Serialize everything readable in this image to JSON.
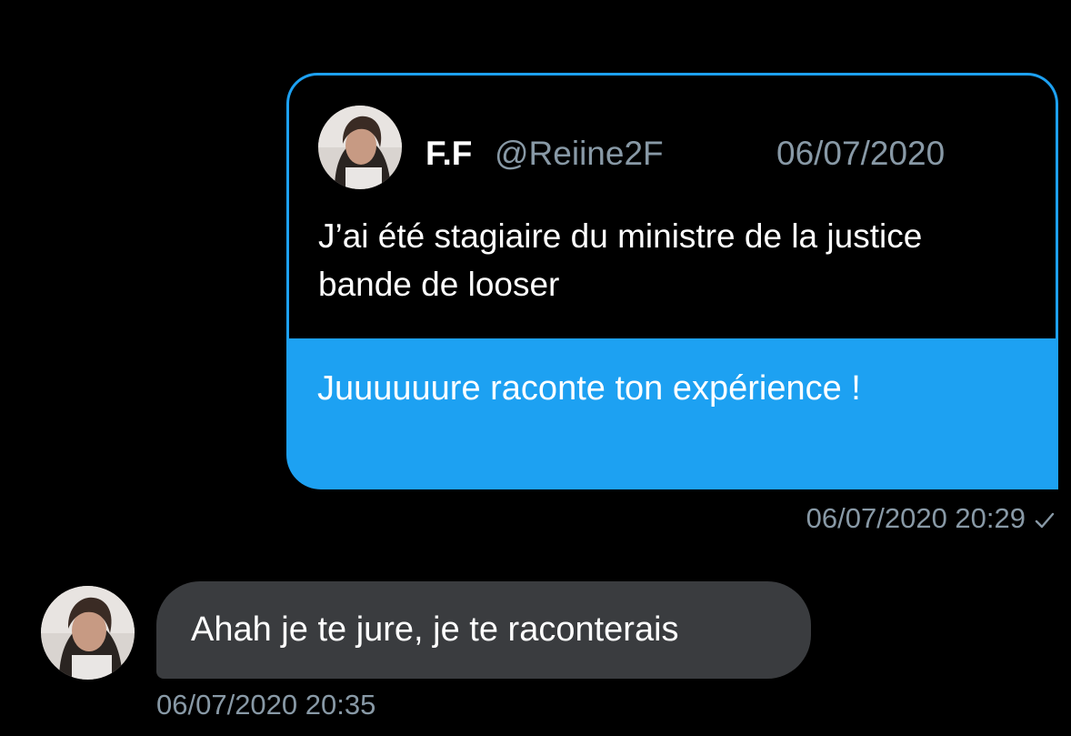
{
  "colors": {
    "background": "#000000",
    "accent": "#1da1f2",
    "muted_text": "#8899a6",
    "received_bubble": "#3a3c3f"
  },
  "sent_message": {
    "quoted_tweet": {
      "display_name": "F.F",
      "handle": "@Reiine2F",
      "date": "06/07/2020",
      "text": "J’ai été stagiaire du ministre de la justice bande de looser",
      "avatar_icon": "profile-photo-avatar"
    },
    "text": "Juuuuuure raconte ton expérience !",
    "timestamp": "06/07/2020 20:29",
    "status_icon": "check-icon"
  },
  "received_message": {
    "avatar_icon": "profile-photo-avatar",
    "text": "Ahah je te jure, je te raconterais",
    "timestamp": "06/07/2020 20:35"
  }
}
